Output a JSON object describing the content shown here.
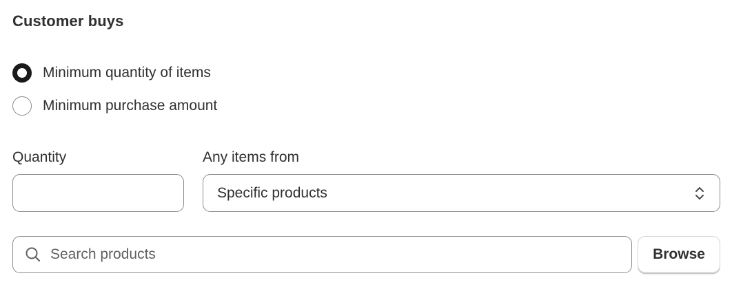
{
  "section": {
    "title": "Customer buys"
  },
  "requirement": {
    "options": [
      {
        "label": "Minimum quantity of items",
        "selected": true
      },
      {
        "label": "Minimum purchase amount",
        "selected": false
      }
    ]
  },
  "quantity": {
    "label": "Quantity",
    "value": ""
  },
  "any_items_from": {
    "label": "Any items from",
    "selected": "Specific products",
    "icon": "chevron-up-down-icon"
  },
  "product_search": {
    "placeholder": "Search products",
    "icon": "search-icon"
  },
  "browse": {
    "label": "Browse"
  },
  "colors": {
    "text": "#303030",
    "border": "#8a8a8a",
    "radio_selected": "#1a1a1a"
  }
}
